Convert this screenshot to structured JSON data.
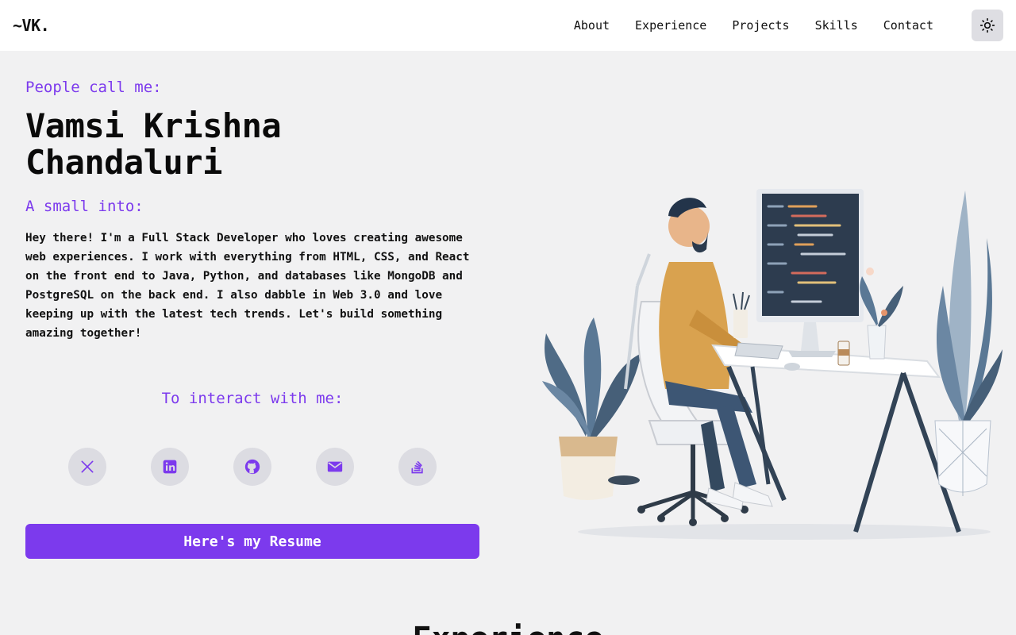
{
  "nav": {
    "logo": "~VK.",
    "links": [
      "About",
      "Experience",
      "Projects",
      "Skills",
      "Contact"
    ],
    "theme_icon": "sun-icon"
  },
  "hero": {
    "eyebrow": "People call me:",
    "name": "Vamsi Krishna Chandaluri",
    "subhead": "A small into:",
    "bio": "Hey there! I'm a Full Stack Developer who loves creating awesome web experiences. I work with everything from HTML, CSS, and React on the front end to Java, Python, and databases like MongoDB and PostgreSQL on the back end. I also dabble in Web 3.0 and love keeping up with the latest tech trends. Let's build something amazing together!",
    "interact_label": "To interact with me:",
    "socials": [
      "x-icon",
      "linkedin-icon",
      "github-icon",
      "mail-icon",
      "stackoverflow-icon"
    ],
    "resume_label": "Here's my Resume"
  },
  "colors": {
    "accent": "#7c3aed",
    "background": "#f1f1f2",
    "navbar": "#ffffff"
  },
  "next_section": {
    "heading": "Experience"
  }
}
